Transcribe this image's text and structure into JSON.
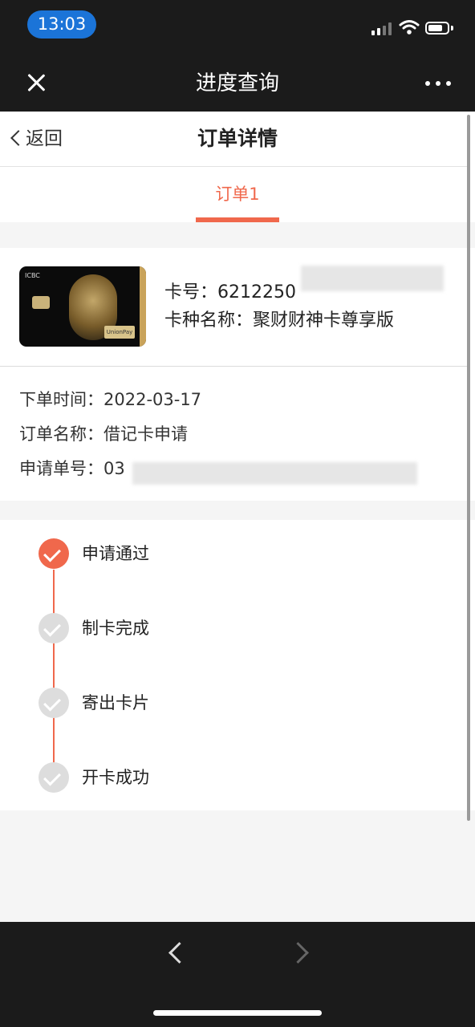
{
  "status_bar": {
    "time": "13:03",
    "icons": [
      "signal-icon",
      "wifi-icon",
      "battery-icon"
    ],
    "time_pill_color": "#1b74d8"
  },
  "title_bar": {
    "title": "进度查询",
    "close_icon": "close-icon",
    "more_icon": "more-icon"
  },
  "nav": {
    "back_label": "返回",
    "page_title": "订单详情"
  },
  "tabs": [
    {
      "label": "订单1",
      "active": true
    }
  ],
  "card": {
    "number_label": "卡号：",
    "number_value": "6212250",
    "type_label": "卡种名称：",
    "type_value": "聚财财神卡尊享版",
    "card_bank_text": "ICBC",
    "card_network_text": "UnionPay"
  },
  "order_info": {
    "time_label": "下单时间：",
    "time_value": "2022-03-17",
    "name_label": "订单名称：",
    "name_value": "借记卡申请",
    "number_label": "申请单号：",
    "number_value": "03"
  },
  "timeline": [
    {
      "label": "申请通过",
      "done": true
    },
    {
      "label": "制卡完成",
      "done": false
    },
    {
      "label": "寄出卡片",
      "done": false
    },
    {
      "label": "开卡成功",
      "done": false
    }
  ],
  "colors": {
    "accent": "#f0684c",
    "inactive_step": "#dddddd",
    "bar_background": "#1b1b1b"
  },
  "bottom_nav": {
    "back_icon": "chevron-left-icon",
    "forward_icon": "chevron-right-icon"
  }
}
